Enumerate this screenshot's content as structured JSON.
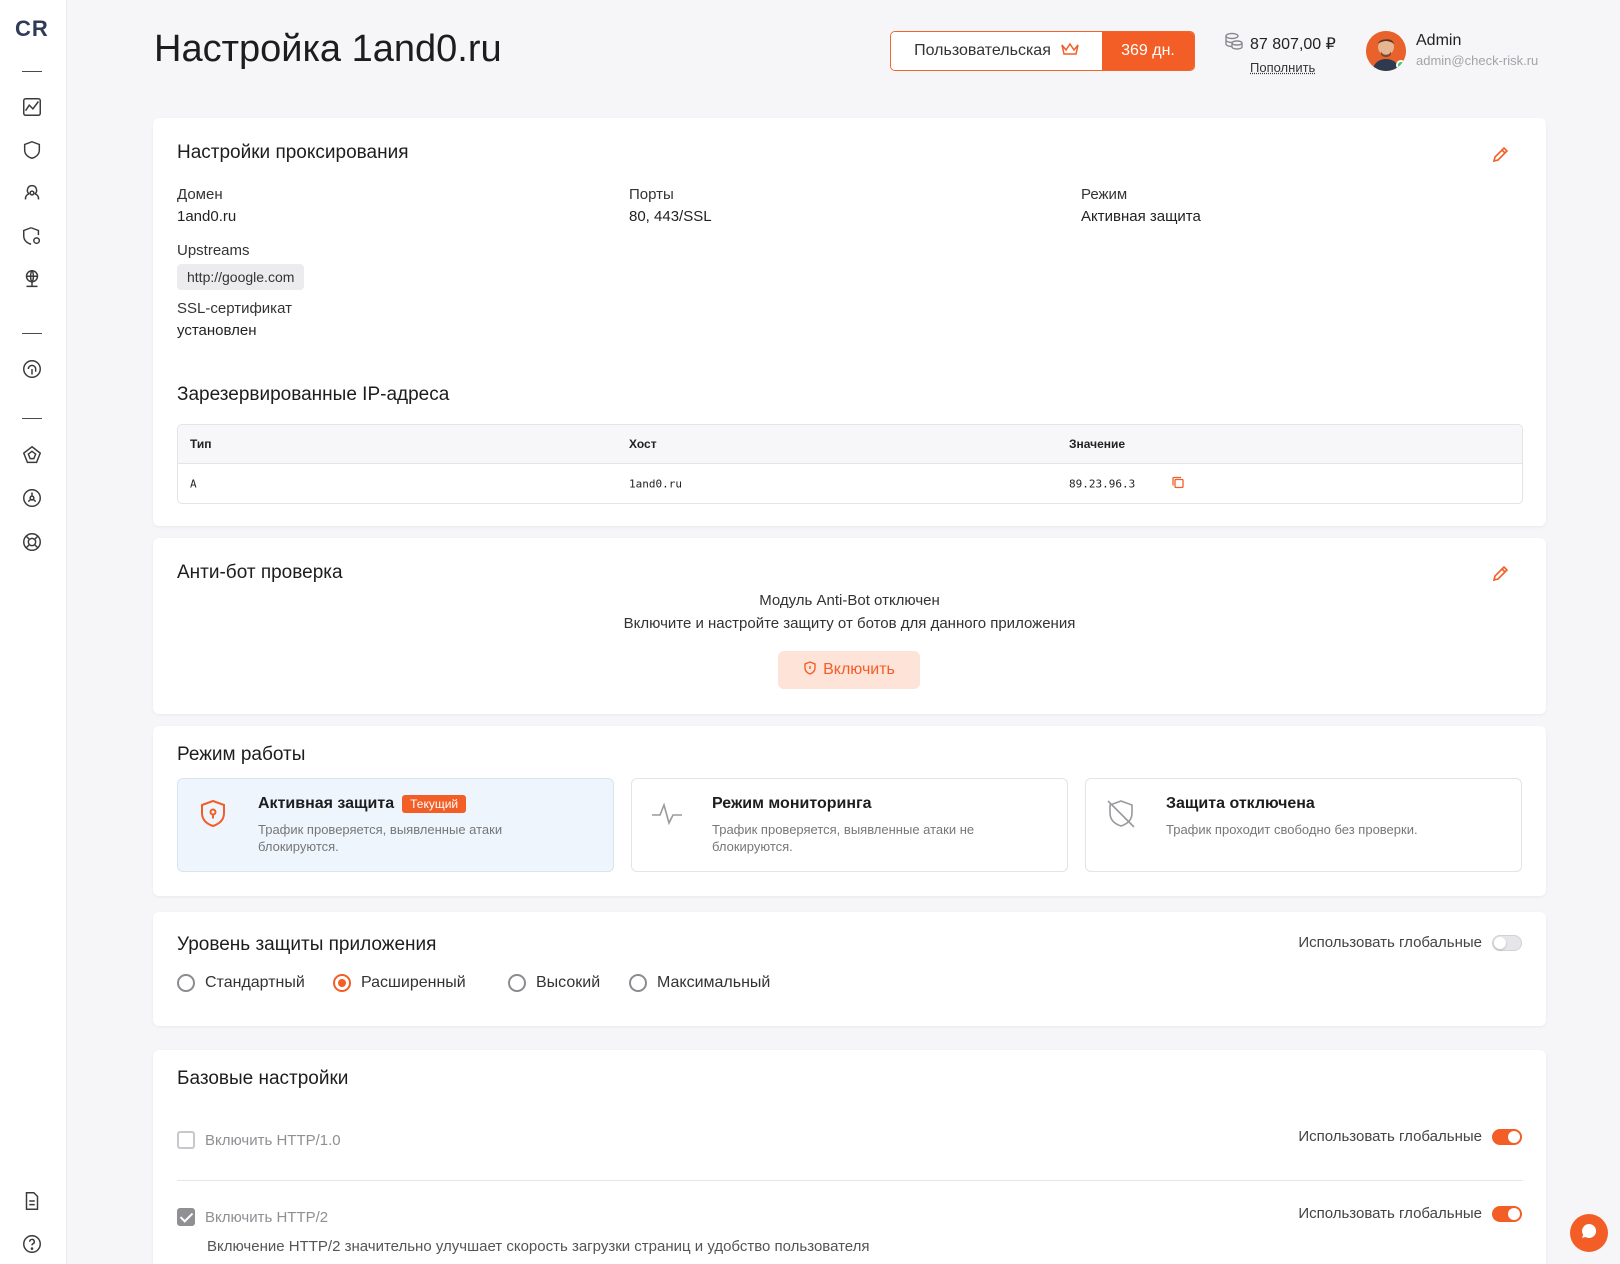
{
  "brand": {
    "logo": "CR",
    "accent": "#f25e26"
  },
  "header": {
    "title": "Настройка 1and0.ru",
    "plan": {
      "name": "Пользовательская",
      "days": "369 дн."
    },
    "balance": {
      "amount": "87 807,00 ₽",
      "topup": "Пополнить"
    },
    "user": {
      "name": "Admin",
      "email": "admin@check-risk.ru"
    }
  },
  "sidebar": {
    "icons": [
      "chart-icon",
      "shield-icon",
      "biohazard-icon",
      "shield-settings-icon",
      "globe-network-icon",
      "fingerprint-icon",
      "pentagon-icon",
      "biohazard-circle-icon",
      "lifebuoy-icon",
      "document-icon",
      "help-icon"
    ]
  },
  "proxy": {
    "title": "Настройки проксирования",
    "domain_label": "Домен",
    "domain_value": "1and0.ru",
    "ports_label": "Порты",
    "ports_value": "80, 443/SSL",
    "mode_label": "Режим",
    "mode_value": "Активная защита",
    "upstreams_label": "Upstreams",
    "upstream": "http://google.com",
    "ssl_label": "SSL-сертификат",
    "ssl_value": "установлен",
    "ip_title": "Зарезервированные IP-адреса",
    "ip_headers": {
      "type": "Тип",
      "host": "Хост",
      "value": "Значение"
    },
    "ip_rows": [
      {
        "type": "A",
        "host": "1and0.ru",
        "value": "89.23.96.3"
      }
    ]
  },
  "antibot": {
    "title": "Анти-бот проверка",
    "line1": "Модуль Anti-Bot отключен",
    "line2": "Включите и настройте защиту от ботов для данного приложения",
    "button": "Включить"
  },
  "work_mode": {
    "title": "Режим работы",
    "modes": [
      {
        "title": "Активная защита",
        "badge": "Текущий",
        "desc": "Трафик проверяется, выявленные атаки блокируются."
      },
      {
        "title": "Режим мониторинга",
        "desc": "Трафик проверяется, выявленные атаки не блокируются."
      },
      {
        "title": "Защита отключена",
        "desc": "Трафик проходит свободно без проверки."
      }
    ]
  },
  "protection_level": {
    "title": "Уровень защиты приложения",
    "use_global": "Использовать глобальные",
    "use_global_on": false,
    "options": [
      "Стандартный",
      "Расширенный",
      "Высокий",
      "Максимальный"
    ],
    "selected": "Расширенный"
  },
  "base_settings": {
    "title": "Базовые настройки",
    "items": [
      {
        "label": "Включить HTTP/1.0",
        "checked": false,
        "use_global": "Использовать глобальные",
        "use_global_on": true
      },
      {
        "label": "Включить HTTP/2",
        "checked": true,
        "desc": "Включение HTTP/2 значительно улучшает скорость загрузки страниц и удобство пользователя",
        "use_global": "Использовать глобальные",
        "use_global_on": true
      }
    ]
  }
}
